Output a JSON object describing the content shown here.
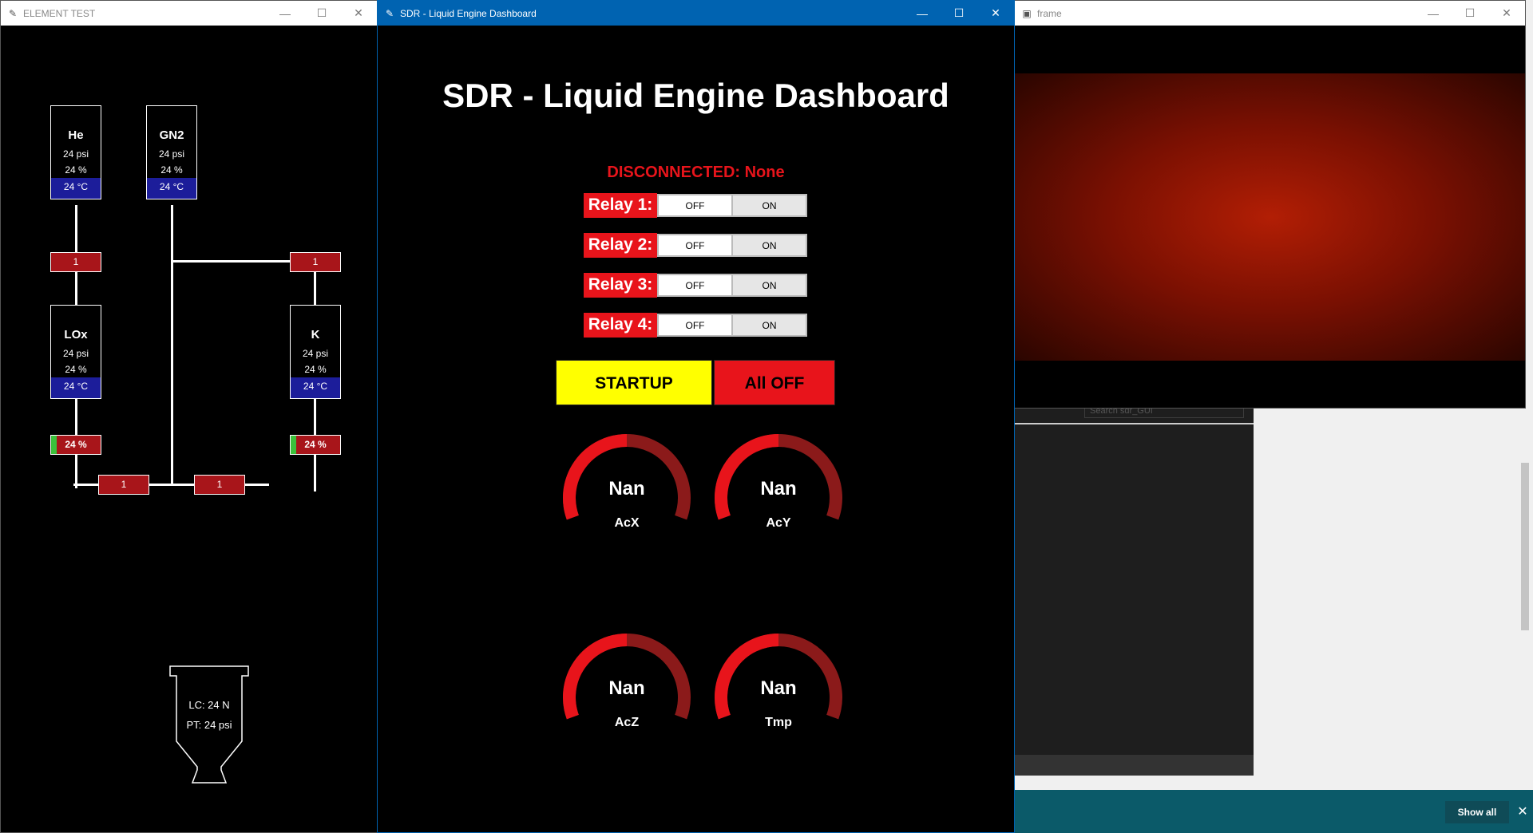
{
  "element_test": {
    "title": "ELEMENT TEST",
    "tanks": [
      {
        "name": "He",
        "pressure": "24 psi",
        "level": "24 %",
        "temp": "24 °C"
      },
      {
        "name": "GN2",
        "pressure": "24 psi",
        "level": "24 %",
        "temp": "24 °C"
      },
      {
        "name": "LOx",
        "pressure": "24 psi",
        "level": "24 %",
        "temp": "24 °C"
      },
      {
        "name": "K",
        "pressure": "24 psi",
        "level": "24 %",
        "temp": "24 °C"
      }
    ],
    "valves": [
      "1",
      "1",
      "1",
      "1"
    ],
    "flow_meters": [
      {
        "label": "24 %",
        "fill": 0.24
      },
      {
        "label": "24 %",
        "fill": 0.24
      }
    ],
    "engine": {
      "lc": "LC: 24 N",
      "pt": "PT: 24 psi"
    }
  },
  "dashboard": {
    "window_title": "SDR - Liquid Engine Dashboard",
    "heading": "SDR - Liquid Engine Dashboard",
    "status": "DISCONNECTED: None",
    "relays": [
      {
        "label": "Relay 1:",
        "off": "OFF",
        "on": "ON"
      },
      {
        "label": "Relay 2:",
        "off": "OFF",
        "on": "ON"
      },
      {
        "label": "Relay 3:",
        "off": "OFF",
        "on": "ON"
      },
      {
        "label": "Relay 4:",
        "off": "OFF",
        "on": "ON"
      }
    ],
    "startup_label": "STARTUP",
    "alloff_label": "All OFF",
    "gauges": [
      {
        "value": "Nan",
        "label": "AcX"
      },
      {
        "value": "Nan",
        "label": "AcY"
      },
      {
        "value": "Nan",
        "label": "AcZ"
      },
      {
        "value": "Nan",
        "label": "Tmp"
      }
    ],
    "colors": {
      "red": "#e8141b",
      "dark_red": "#8b1a1a",
      "yellow": "#ffff00"
    }
  },
  "frame": {
    "title": "frame"
  },
  "notification": {
    "show_all": "Show all"
  },
  "ide": {
    "search_placeholder": "Search sdr_GUI"
  }
}
